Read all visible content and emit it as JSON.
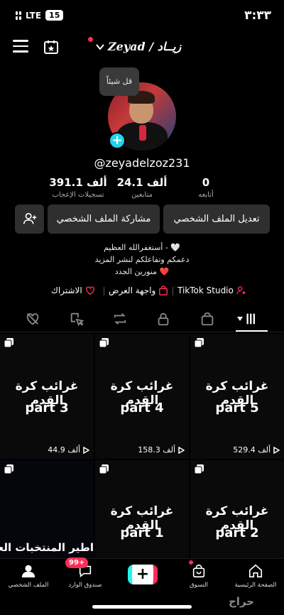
{
  "status": {
    "time": "٣:٣٣",
    "network": "LTE",
    "battery": "15"
  },
  "header": {
    "username": "Zeyad / زيــاد"
  },
  "bubble": "قل شيئاً",
  "profile": {
    "handle": "@zeyadelzoz231"
  },
  "stats": [
    {
      "num": "0",
      "label": "أتابعه"
    },
    {
      "num": "24.1 ألف",
      "label": "متابعين"
    },
    {
      "num": "391.1 ألف",
      "label": "تسجيلات الإعجاب"
    }
  ],
  "buttons": {
    "edit": "تعديل الملف الشخصي",
    "share": "مشاركة الملف الشخصي"
  },
  "bio": [
    "أستغفرالله العظيم - 🤍",
    "دعمكم وتفاعلكم لنشر المزيد",
    "منورين الجدد ❤️"
  ],
  "links": {
    "studio": "TikTok Studio",
    "showcase": "واجهة العرض",
    "subscribe": "الاشتراك"
  },
  "videos": [
    {
      "title": "غرائب كرة القدم",
      "part": "part 5",
      "views": "529.4 ألف"
    },
    {
      "title": "غرائب كرة القدم",
      "part": "part 4",
      "views": "158.3 ألف"
    },
    {
      "title": "غرائب كرة القدم",
      "part": "part 3",
      "views": "44.9 ألف"
    },
    {
      "title": "غرائب كرة القدم",
      "part": "part 2",
      "views": ""
    },
    {
      "title": "غرائب كرة القدم",
      "part": "part 1",
      "views": ""
    },
    {
      "title": "اطير المنتخبات العرب",
      "part": "",
      "views": ""
    }
  ],
  "nav": {
    "home": "الصفحة الرئيسية",
    "shop": "التسوق",
    "inbox": "صندوق الوارد",
    "inbox_badge": "99+",
    "profile": "الملف الشخصي"
  },
  "watermark": "حراج",
  "colors": {
    "accent": "#fe2c55",
    "cyan": "#20d5ec"
  }
}
